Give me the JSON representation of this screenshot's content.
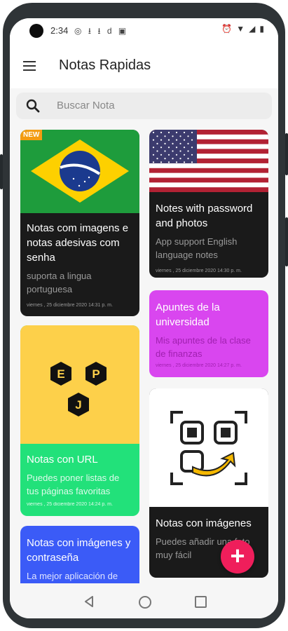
{
  "status_bar": {
    "time": "2:34",
    "left_icons": "◎ ⭳ ⭳ d ▣",
    "right_icons": [
      "⏰",
      "▼",
      "◢",
      "▮"
    ]
  },
  "app": {
    "title": "Notas Rapidas"
  },
  "search": {
    "placeholder": "Buscar Nota"
  },
  "colors": {
    "fab": "#ef1e5b",
    "dark_card": "#1a1a1a",
    "purple_card": "#d946ef",
    "green_card": "#22e17a",
    "blue_card": "#3b5bf7",
    "yellow": "#fdd04a"
  },
  "notes": [
    {
      "badge": "NEW",
      "title": "Notas com imagens e notas adesivas com senha",
      "description": "suporta a lingua portuguesa",
      "date": "viernes , 25 diciembre 2020 14:31 p. m.",
      "image": "brazil-flag"
    },
    {
      "title": "Notes with password and photos",
      "description": "App support English language notes",
      "date": "viernes , 25 diciembre 2020 14:30 p. m.",
      "image": "usa-flag"
    },
    {
      "title": "Apuntes de la universidad",
      "description": "Mis apuntes de la clase de finanzas",
      "date": "viernes , 25 diciembre 2020 14:27 p. m."
    },
    {
      "title": "Notas con URL",
      "description": "Puedes poner listas de tus páginas favoritas",
      "date": "viernes , 25 diciembre 2020 14:24 p. m.",
      "image": "epj-logo",
      "logo_letters": [
        "E",
        "P",
        "J"
      ]
    },
    {
      "title": "Notas con imágenes",
      "description": "Puedes añadir una foto muy fácil",
      "date": "",
      "image": "scan-icon"
    },
    {
      "title": "Notas con imágenes y contraseña",
      "description": "La mejor aplicación de",
      "date": ""
    }
  ],
  "fab": {
    "label": "+"
  }
}
